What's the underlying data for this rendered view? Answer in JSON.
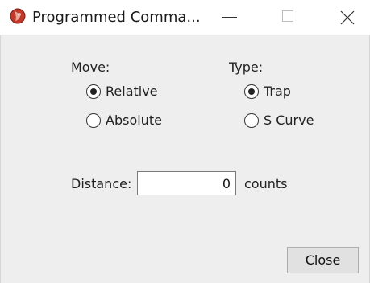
{
  "window": {
    "title": "Programmed Comma...",
    "icon": "app-logo-icon",
    "controls": [
      "minimize-icon",
      "maximize-icon",
      "close-icon"
    ]
  },
  "move": {
    "label": "Move:",
    "options": [
      {
        "label": "Relative",
        "checked": true
      },
      {
        "label": "Absolute",
        "checked": false
      }
    ]
  },
  "type": {
    "label": "Type:",
    "options": [
      {
        "label": "Trap",
        "checked": true
      },
      {
        "label": "S Curve",
        "checked": false
      }
    ]
  },
  "distance": {
    "label": "Distance:",
    "value": "0",
    "unit": "counts"
  },
  "buttons": {
    "close_label": "Close"
  },
  "colors": {
    "titlebar": "#ffffff",
    "client_bg": "#eeeeee",
    "button_bg": "#e1e1e1",
    "icon_red": "#c0392b"
  }
}
